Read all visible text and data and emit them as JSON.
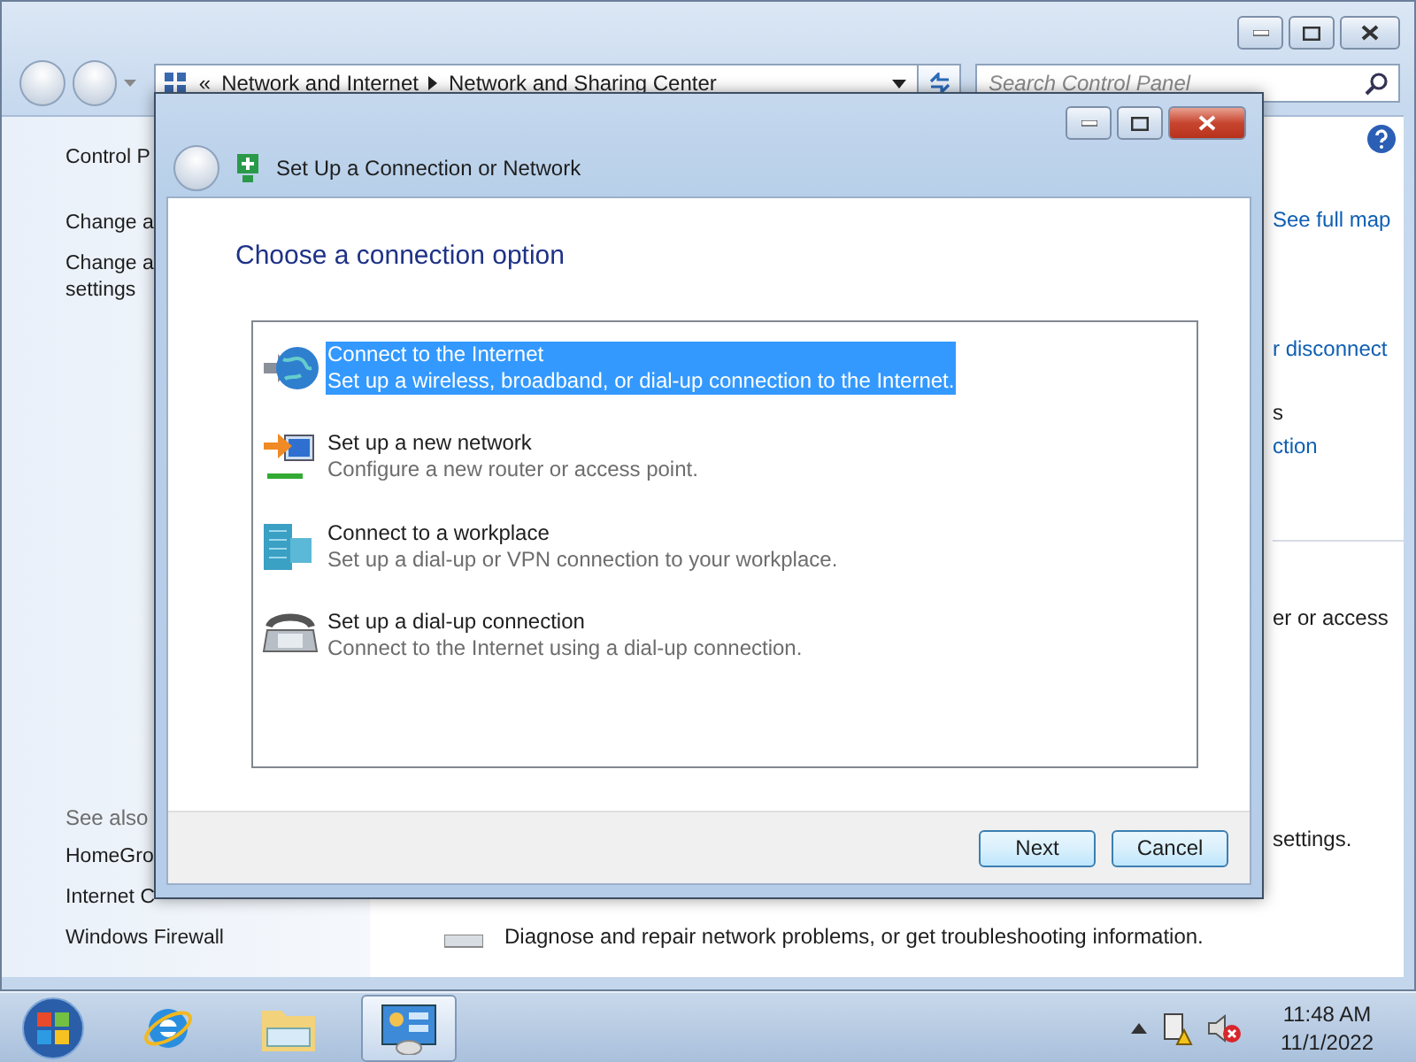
{
  "main_window": {
    "address_bar": {
      "overflow": "«",
      "crumbs": [
        "Network and Internet",
        "Network and Sharing Center"
      ]
    },
    "search": {
      "placeholder": "Search Control Panel"
    },
    "sidebar": {
      "items": [
        "Control P",
        "Change a",
        "Change a\nsettings"
      ],
      "see_also_heading": "See also",
      "see_also": [
        "HomeGro",
        "Internet C",
        "Windows Firewall"
      ]
    },
    "right_column": [
      {
        "text": "See full map",
        "kind": "link"
      },
      {
        "text": "r disconnect",
        "kind": "link"
      },
      {
        "text": "s",
        "kind": "text"
      },
      {
        "text": "ction",
        "kind": "link"
      },
      {
        "text": "er or access",
        "kind": "text"
      },
      {
        "text": "settings.",
        "kind": "text"
      }
    ],
    "troubleshoot_text": "Diagnose and repair network problems, or get troubleshooting information."
  },
  "dialog": {
    "title": "Set Up a Connection or Network",
    "heading": "Choose a connection option",
    "options": [
      {
        "kind": "internet",
        "title": "Connect to the Internet",
        "description": "Set up a wireless, broadband, or dial-up connection to the Internet.",
        "selected": true
      },
      {
        "kind": "network",
        "title": "Set up a new network",
        "description": "Configure a new router or access point.",
        "selected": false
      },
      {
        "kind": "workplace",
        "title": "Connect to a workplace",
        "description": "Set up a dial-up or VPN connection to your workplace.",
        "selected": false
      },
      {
        "kind": "dialup",
        "title": "Set up a dial-up connection",
        "description": "Connect to the Internet using a dial-up connection.",
        "selected": false
      }
    ],
    "buttons": [
      "Next",
      "Cancel"
    ]
  },
  "taskbar": {
    "items": [
      {
        "kind": "start",
        "selected": false
      },
      {
        "kind": "browser",
        "selected": false
      },
      {
        "kind": "explorer",
        "selected": false
      },
      {
        "kind": "control_panel",
        "selected": true
      }
    ],
    "time": "11:48 AM",
    "date": "11/1/2022"
  }
}
